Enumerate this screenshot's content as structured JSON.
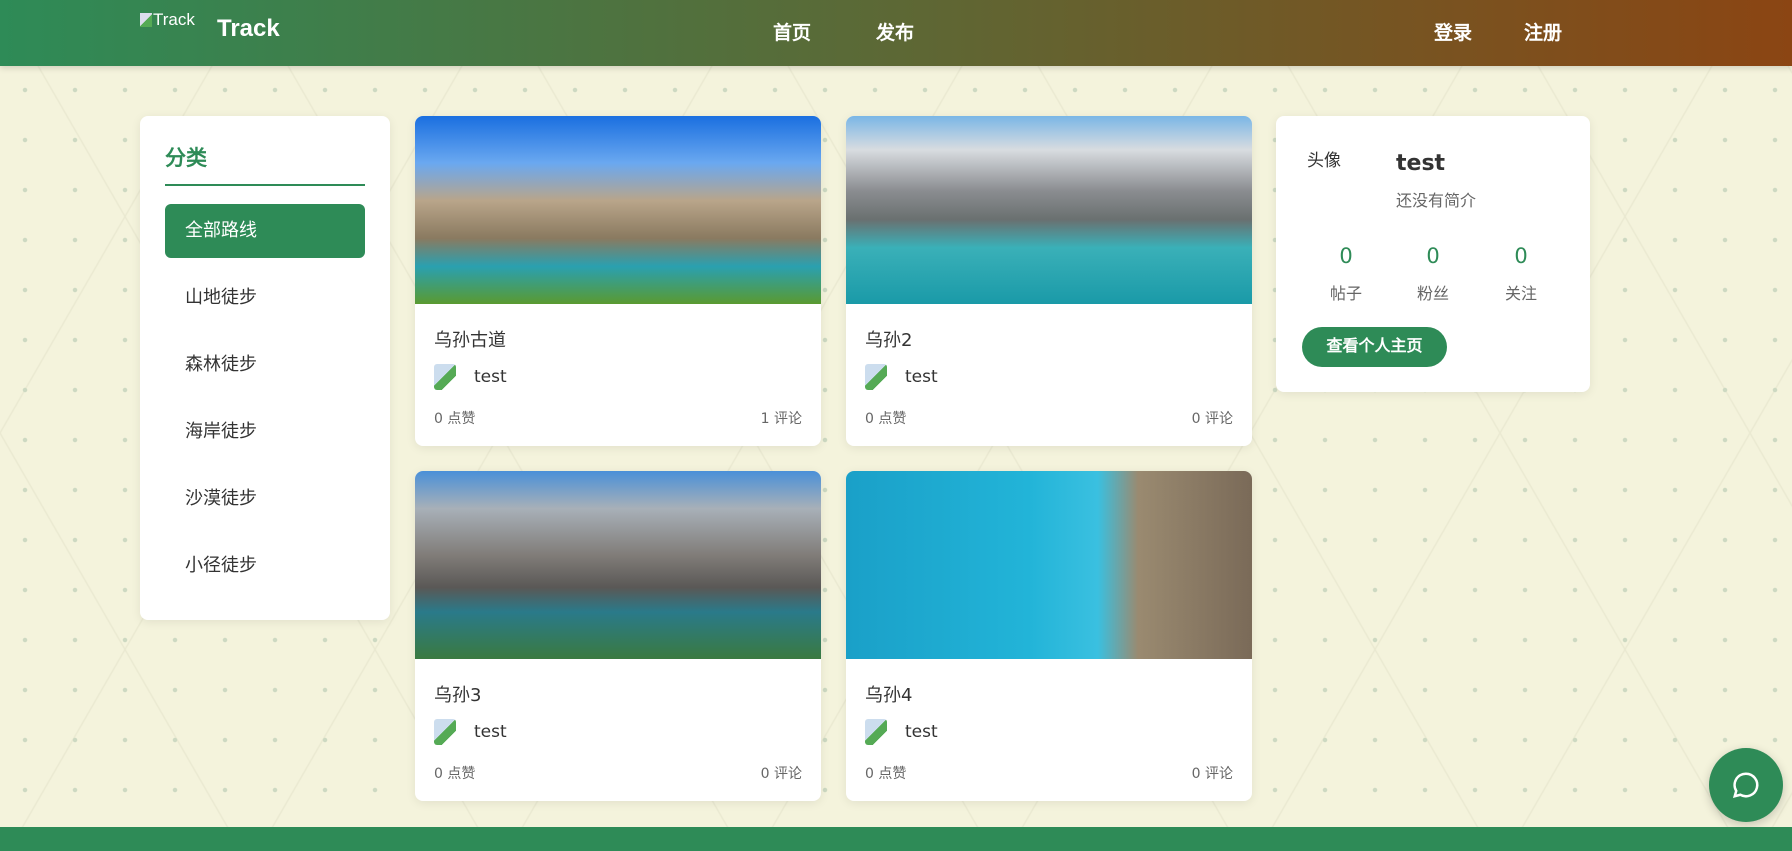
{
  "header": {
    "logo_alt": "Track",
    "brand": "Track",
    "nav": [
      "首页",
      "发布"
    ],
    "login": "登录",
    "register": "注册"
  },
  "sidebar": {
    "title": "分类",
    "items": [
      "全部路线",
      "山地徒步",
      "森林徒步",
      "海岸徒步",
      "沙漠徒步",
      "小径徒步"
    ],
    "active": "全部路线"
  },
  "posts": [
    {
      "title": "乌孙古道",
      "author": "test",
      "likes": "0 点赞",
      "comments": "1 评论"
    },
    {
      "title": "乌孙2",
      "author": "test",
      "likes": "0 点赞",
      "comments": "0 评论"
    },
    {
      "title": "乌孙3",
      "author": "test",
      "likes": "0 点赞",
      "comments": "0 评论"
    },
    {
      "title": "乌孙4",
      "author": "test",
      "likes": "0 点赞",
      "comments": "0 评论"
    }
  ],
  "profile": {
    "avatar_alt": "头像",
    "name": "test",
    "bio": "还没有简介",
    "stats": [
      {
        "value": "0",
        "label": "帖子"
      },
      {
        "value": "0",
        "label": "粉丝"
      },
      {
        "value": "0",
        "label": "关注"
      }
    ],
    "button": "查看个人主页"
  },
  "colors": {
    "accent": "#2e8b57",
    "header_end": "#8b4513",
    "background": "#f4f3dc"
  },
  "icons": {
    "chat": "chat-bubble-icon"
  }
}
